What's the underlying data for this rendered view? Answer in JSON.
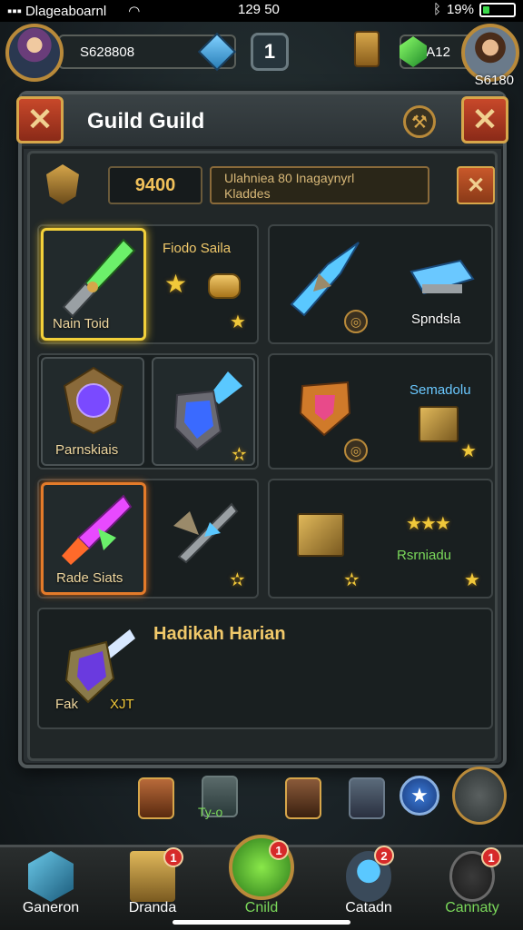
{
  "status_bar": {
    "carrier": "Dlageaboarnl",
    "time": "129 50",
    "battery": "19%"
  },
  "hud": {
    "player_value": "S628808",
    "level": "1",
    "currency": "A12",
    "right_score": "S6180"
  },
  "modal": {
    "title": "Guild Guild",
    "score": "9400",
    "info_line1": "Ulahniea 80 Inagaynyrl",
    "info_line2": "Kladdes"
  },
  "items": {
    "slot1_name": "Fiodo Saila",
    "slot1_label": "Nain Toid",
    "slot2_label": "Spndsla",
    "slot3_label": "Parnskiais",
    "slot4_name": "Semadolu",
    "slot5_label": "Rade Siats",
    "slot6_label": "Rsrniadu",
    "slot7_heading": "Hadikah Harian",
    "slot7_label": "Fak",
    "slot7_sub": "XJT"
  },
  "dock": {
    "label": "Ty-o"
  },
  "nav": {
    "items": [
      {
        "label": "Ganeron",
        "badge": ""
      },
      {
        "label": "Dranda",
        "badge": "1"
      },
      {
        "label": "Cnild",
        "badge": "1"
      },
      {
        "label": "Catadn",
        "badge": "2"
      },
      {
        "label": "Cannaty",
        "badge": "1"
      }
    ]
  },
  "colors": {
    "gold_border": "#f2d03a",
    "orange_border": "#e47b2a",
    "active_nav": "#7ad85a",
    "badge": "#d62a2a"
  }
}
